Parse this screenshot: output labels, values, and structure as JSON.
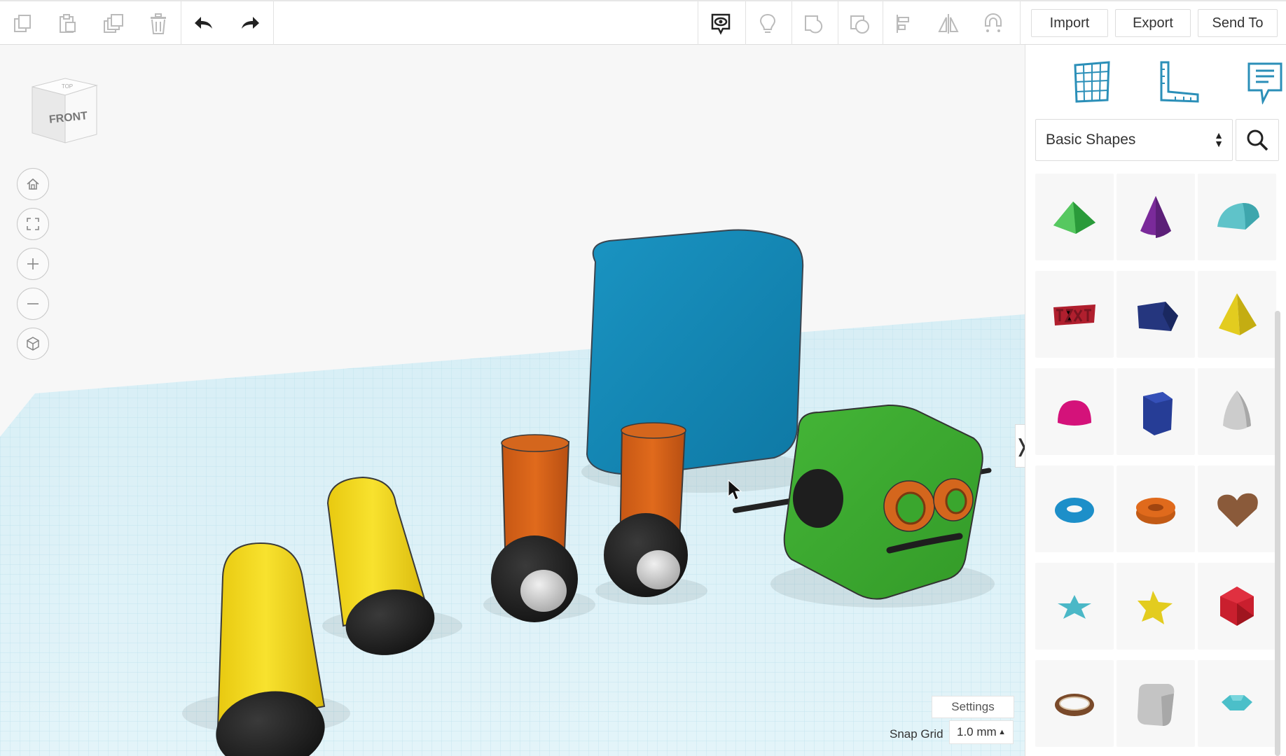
{
  "toolbar": {
    "icons": [
      "copy-icon",
      "paste-icon",
      "duplicate-icon",
      "delete-icon",
      "undo-icon",
      "redo-icon",
      "show-all-icon",
      "note-light-bulb-icon",
      "group-icon",
      "ungroup-icon",
      "align-icon",
      "mirror-icon",
      "magnet-icon"
    ],
    "import_label": "Import",
    "export_label": "Export",
    "send_to_label": "Send To"
  },
  "viewcube": {
    "face_label": "FRONT",
    "top_label": "TOP"
  },
  "view_controls": [
    "home-icon",
    "fit-view-icon",
    "zoom-in-icon",
    "zoom-out-icon",
    "orthographic-icon"
  ],
  "workplane": {
    "settings_label": "Settings",
    "snap_grid_label": "Snap Grid",
    "snap_grid_value": "1.0 mm",
    "collapse_handle": "❭"
  },
  "panel": {
    "top_icons": [
      "workplane-grid-icon",
      "ruler-icon",
      "notes-icon"
    ],
    "category_select": "Basic Shapes",
    "category_arrows": "▲▼",
    "shapes": [
      {
        "name": "roof",
        "color": "#3bb54a"
      },
      {
        "name": "cone",
        "color": "#7a2a9a"
      },
      {
        "name": "round-roof",
        "color": "#5fc3c9"
      },
      {
        "name": "text",
        "color": "#b01f2e"
      },
      {
        "name": "box-dark",
        "color": "#25367e"
      },
      {
        "name": "pyramid",
        "color": "#e3cc1f"
      },
      {
        "name": "half-sphere",
        "color": "#d4127a"
      },
      {
        "name": "polygon",
        "color": "#263d96"
      },
      {
        "name": "paraboloid",
        "color": "#cccccc"
      },
      {
        "name": "torus",
        "color": "#1d8fc9"
      },
      {
        "name": "tube",
        "color": "#e06a1c"
      },
      {
        "name": "heart",
        "color": "#8a5a3a"
      },
      {
        "name": "star-flat",
        "color": "#4bb8c7"
      },
      {
        "name": "star",
        "color": "#e3cc1f"
      },
      {
        "name": "icosahedron",
        "color": "#c91f2e"
      },
      {
        "name": "ring",
        "color": "#7a4a2a"
      },
      {
        "name": "round-box",
        "color": "#bdbdbd"
      },
      {
        "name": "gem",
        "color": "#4bbfc9"
      }
    ]
  },
  "scene_colors": {
    "grid": "#bfe3ee",
    "blue_box": "#1488b4",
    "green_head": "#3aa62e",
    "orange": "#d4661d",
    "yellow": "#f2d91a",
    "black": "#1e1e1e",
    "gray": "#cfcfcf"
  }
}
